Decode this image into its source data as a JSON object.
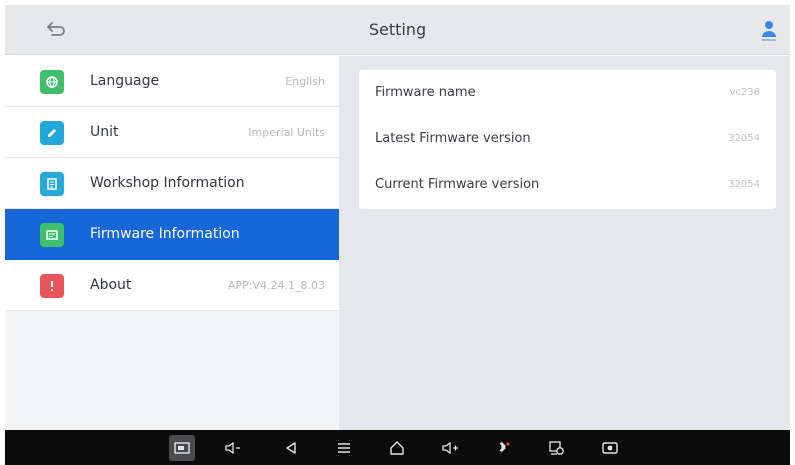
{
  "header": {
    "title": "Setting",
    "back_icon": "back-arrow-icon",
    "user_icon": "user-icon"
  },
  "menu": {
    "items": [
      {
        "label": "Language",
        "value": "English",
        "icon": "language-icon",
        "color": "#3fbf6c"
      },
      {
        "label": "Unit",
        "value": "Imperial Units",
        "icon": "unit-icon",
        "color": "#23a7d8"
      },
      {
        "label": "Workshop Information",
        "value": "",
        "icon": "workshop-icon",
        "color": "#28a8d6"
      },
      {
        "label": "Firmware Information",
        "value": "",
        "icon": "firmware-icon",
        "color": "#3fbf6c",
        "active": true
      },
      {
        "label": "About",
        "value": "APP:V4.24.1_8.03",
        "icon": "about-icon",
        "color": "#e8555a"
      }
    ]
  },
  "firmware": {
    "rows": [
      {
        "label": "Firmware name",
        "value": "vc238"
      },
      {
        "label": "Latest Firmware version",
        "value": "32054"
      },
      {
        "label": "Current Firmware version",
        "value": "32054"
      }
    ]
  },
  "navbar": {
    "icons": [
      "screenshot-icon",
      "volume-down-icon",
      "back-icon",
      "menu-icon",
      "home-icon",
      "volume-up-icon",
      "vci-icon",
      "settings-icon",
      "record-icon"
    ],
    "active_icon": "screenshot-icon"
  },
  "colors": {
    "accent": "#1767d8",
    "navbar": "#0b0b0c",
    "header": "#e6e8ec",
    "panel": "#e4e7ec"
  }
}
